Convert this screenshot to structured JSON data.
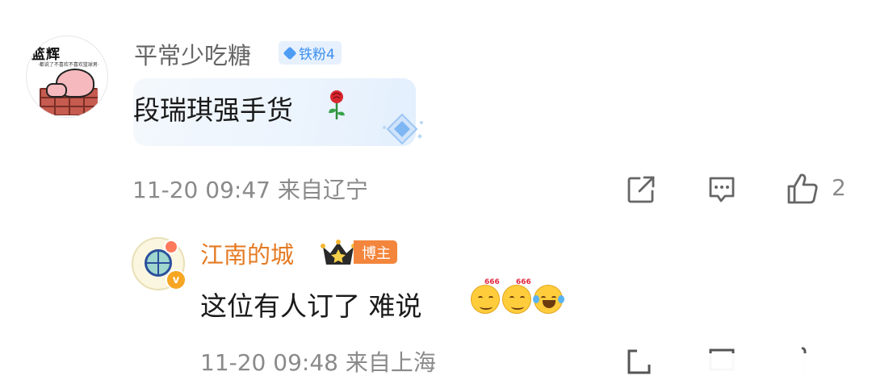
{
  "comment": {
    "avatar_logo": "篮辉",
    "avatar_subtext": "·都说了不喜欢不喜欢篮球男·",
    "username": "平常少吃糖",
    "fan_badge": "铁粉4",
    "text": "段瑞琪强手货",
    "text_icon": "rose-icon",
    "timestamp": "11-20 09:47",
    "location": "来自辽宁",
    "like_count": "2"
  },
  "reply": {
    "username": "江南的城",
    "badge": "博主",
    "text": "这位有人订了  难说",
    "emoji_tag": "666",
    "timestamp": "11-20 09:48",
    "location": "来自上海",
    "verified_mark": "v"
  },
  "colors": {
    "accent_blue": "#3c8ff0",
    "blogger_orange": "#f3853c",
    "username_reply": "#e57a22",
    "meta_grey": "#8a8a8a"
  }
}
